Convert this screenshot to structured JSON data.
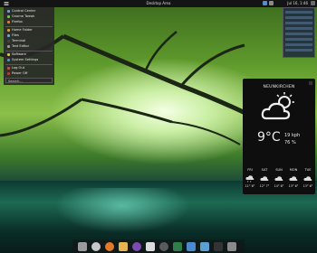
{
  "topbar": {
    "title": "Desktop Area",
    "clock": "Jul 16, 1:46"
  },
  "appmenu": {
    "items": [
      {
        "label": "Control Center",
        "icon": "settings-icon",
        "color": "#6aa0e0"
      },
      {
        "label": "Gnome Tweak",
        "icon": "tweak-icon",
        "color": "#7fbf4a"
      },
      {
        "label": "Firefox",
        "icon": "firefox-icon",
        "color": "#e07a2a"
      },
      {
        "label": "Home Folder",
        "icon": "home-icon",
        "color": "#d0a040"
      },
      {
        "label": "Files",
        "icon": "files-icon",
        "color": "#7aa0d0"
      },
      {
        "label": "Terminal",
        "icon": "terminal-icon",
        "color": "#444444"
      },
      {
        "label": "Text Editor",
        "icon": "text-editor-icon",
        "color": "#9a9a9a"
      },
      {
        "label": "Software",
        "icon": "software-icon",
        "color": "#e0c040"
      },
      {
        "label": "System Settings",
        "icon": "system-icon",
        "color": "#5a8ad0"
      },
      {
        "label": "Log Out",
        "icon": "logout-icon",
        "color": "#c05050"
      },
      {
        "label": "Power Off",
        "icon": "power-icon",
        "color": "#b04040"
      }
    ],
    "search_placeholder": "Search..."
  },
  "weather": {
    "location": "NEUNKIRCHEN",
    "temperature": "9°C",
    "wind": "19 kph",
    "humidity": "76 %",
    "condition_icon": "partly-cloudy-icon",
    "forecast": [
      {
        "day": "FRI",
        "icon": "cloud-rain-icon",
        "temps": "11° 6°"
      },
      {
        "day": "SAT",
        "icon": "cloud-icon",
        "temps": "12° 7°"
      },
      {
        "day": "SUN",
        "icon": "cloud-icon",
        "temps": "14° 6°"
      },
      {
        "day": "MON",
        "icon": "cloud-icon",
        "temps": "13° 6°"
      },
      {
        "day": "TUE",
        "icon": "cloud-icon",
        "temps": "13° 6°"
      }
    ]
  },
  "dock": {
    "apps": [
      {
        "name": "file-manager-icon",
        "color": "#9a9a9a"
      },
      {
        "name": "search-icon",
        "color": "#c8c8c8"
      },
      {
        "name": "firefox-icon",
        "color": "#e07a2a"
      },
      {
        "name": "files-icon",
        "color": "#e6b450"
      },
      {
        "name": "video-icon",
        "color": "#7c4ab0"
      },
      {
        "name": "text-icon",
        "color": "#dcdcdc"
      },
      {
        "name": "settings-icon",
        "color": "#5a5a5a"
      },
      {
        "name": "monitor-icon",
        "color": "#2e7d4a"
      },
      {
        "name": "image-icon",
        "color": "#4a8ad0"
      },
      {
        "name": "tools-icon",
        "color": "#5aa0d0"
      },
      {
        "name": "terminal-icon",
        "color": "#333333"
      },
      {
        "name": "trash-icon",
        "color": "#8a8a8a"
      }
    ]
  }
}
